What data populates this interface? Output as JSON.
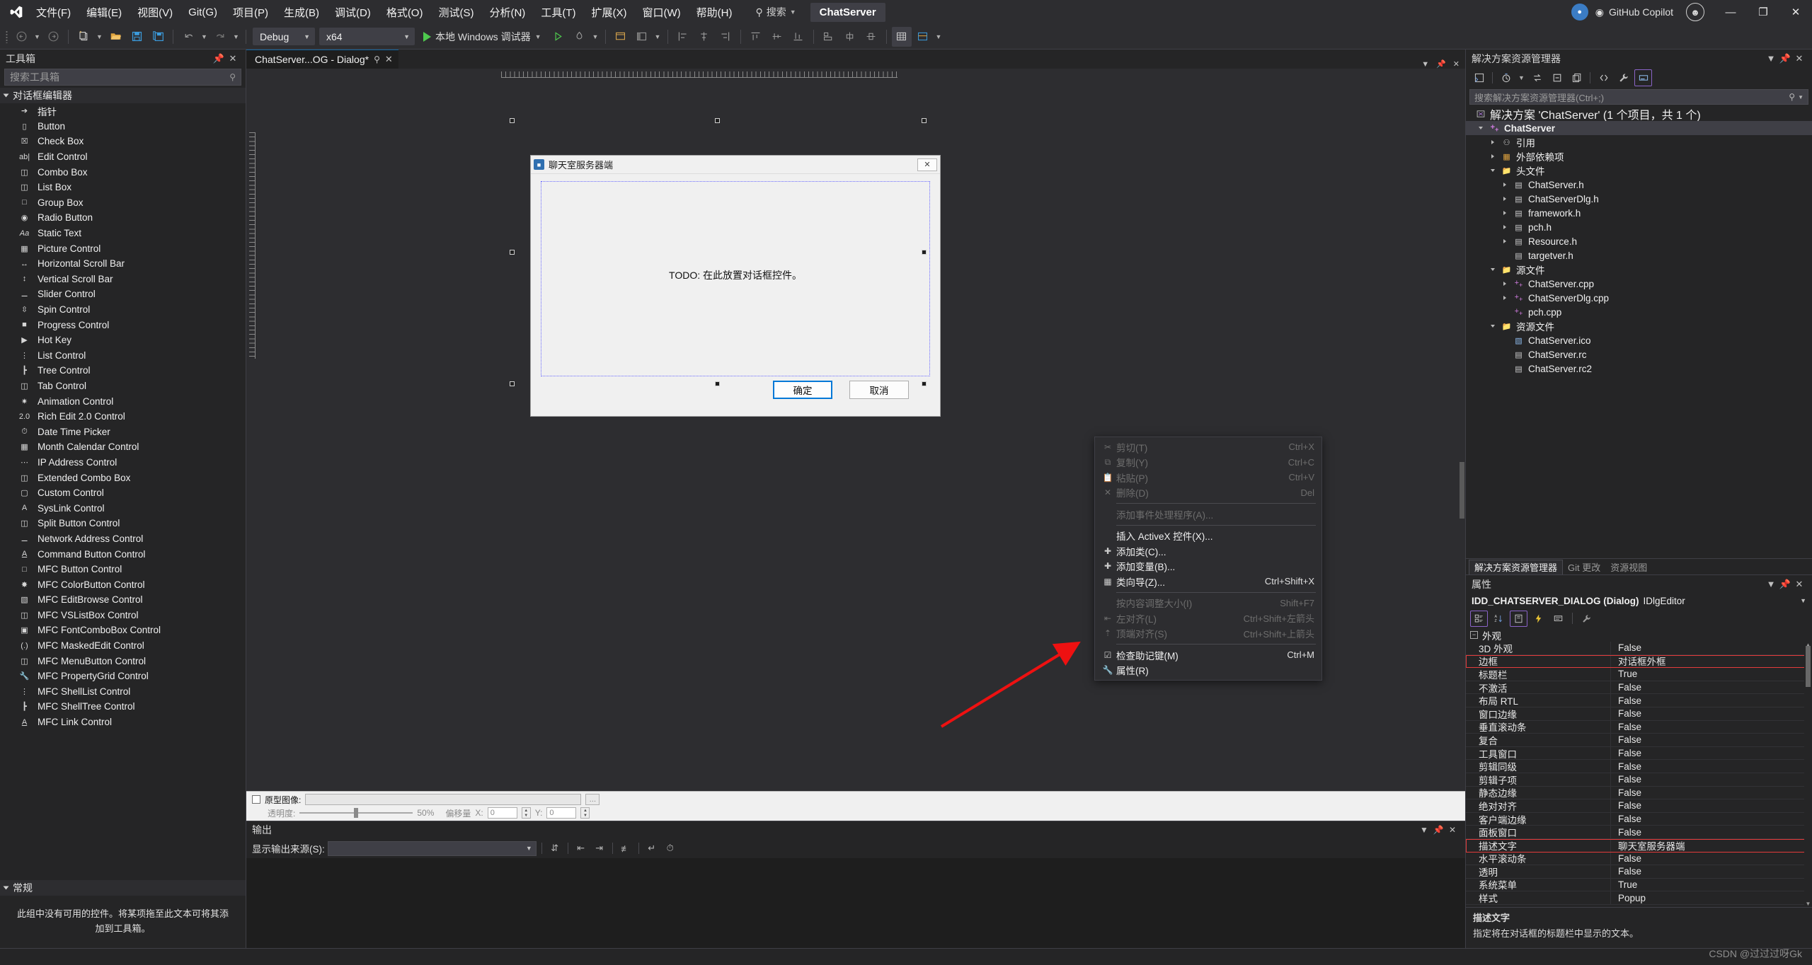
{
  "menubar": {
    "logo_icon": "visual-studio-logo",
    "items": [
      "文件(F)",
      "编辑(E)",
      "视图(V)",
      "Git(G)",
      "项目(P)",
      "生成(B)",
      "调试(D)",
      "格式(O)",
      "测试(S)",
      "分析(N)",
      "工具(T)",
      "扩展(X)",
      "窗口(W)",
      "帮助(H)"
    ],
    "search_label": "搜索",
    "project_chip": "ChatServer",
    "copilot_label": "GitHub Copilot",
    "minimize": "—",
    "maximize": "❐",
    "close": "✕"
  },
  "toolbar": {
    "back_icon": "arrow-back-icon",
    "forward_icon": "arrow-forward-icon",
    "new_project_icon": "new-project-icon",
    "open_icon": "open-folder-icon",
    "save_icon": "save-icon",
    "save_all_icon": "save-all-icon",
    "undo_icon": "undo-icon",
    "redo_icon": "redo-icon",
    "config": "Debug",
    "platform": "x64",
    "run_label": "本地 Windows 调试器",
    "hot_reload_icon": "hot-reload-icon"
  },
  "toolbox": {
    "title": "工具箱",
    "search_placeholder": "搜索工具箱",
    "group1": "对话框编辑器",
    "items": [
      {
        "label": "指针",
        "icon": "pointer-icon"
      },
      {
        "label": "Button",
        "icon": "button-icon"
      },
      {
        "label": "Check Box",
        "icon": "checkbox-icon"
      },
      {
        "label": "Edit Control",
        "icon": "edit-control-icon"
      },
      {
        "label": "Combo Box",
        "icon": "combobox-icon"
      },
      {
        "label": "List Box",
        "icon": "listbox-icon"
      },
      {
        "label": "Group Box",
        "icon": "groupbox-icon"
      },
      {
        "label": "Radio Button",
        "icon": "radio-icon"
      },
      {
        "label": "Static Text",
        "icon": "static-text-icon"
      },
      {
        "label": "Picture Control",
        "icon": "picture-icon"
      },
      {
        "label": "Horizontal Scroll Bar",
        "icon": "hscroll-icon"
      },
      {
        "label": "Vertical Scroll Bar",
        "icon": "vscroll-icon"
      },
      {
        "label": "Slider Control",
        "icon": "slider-icon"
      },
      {
        "label": "Spin Control",
        "icon": "spin-icon"
      },
      {
        "label": "Progress Control",
        "icon": "progress-icon"
      },
      {
        "label": "Hot Key",
        "icon": "hotkey-icon"
      },
      {
        "label": "List Control",
        "icon": "list-control-icon"
      },
      {
        "label": "Tree Control",
        "icon": "tree-control-icon"
      },
      {
        "label": "Tab Control",
        "icon": "tab-control-icon"
      },
      {
        "label": "Animation Control",
        "icon": "animation-icon"
      },
      {
        "label": "Rich Edit 2.0 Control",
        "icon": "richedit-icon"
      },
      {
        "label": "Date Time Picker",
        "icon": "datetime-icon"
      },
      {
        "label": "Month Calendar Control",
        "icon": "calendar-icon"
      },
      {
        "label": "IP Address Control",
        "icon": "ip-address-icon"
      },
      {
        "label": "Extended Combo Box",
        "icon": "ext-combo-icon"
      },
      {
        "label": "Custom Control",
        "icon": "custom-control-icon"
      },
      {
        "label": "SysLink Control",
        "icon": "syslink-icon"
      },
      {
        "label": "Split Button Control",
        "icon": "split-button-icon"
      },
      {
        "label": "Network Address Control",
        "icon": "network-address-icon"
      },
      {
        "label": "Command Button Control",
        "icon": "command-button-icon"
      },
      {
        "label": "MFC Button Control",
        "icon": "mfc-button-icon"
      },
      {
        "label": "MFC ColorButton Control",
        "icon": "mfc-colorbutton-icon"
      },
      {
        "label": "MFC EditBrowse Control",
        "icon": "mfc-editbrowse-icon"
      },
      {
        "label": "MFC VSListBox Control",
        "icon": "mfc-vslistbox-icon"
      },
      {
        "label": "MFC FontComboBox Control",
        "icon": "mfc-fontcombo-icon"
      },
      {
        "label": "MFC MaskedEdit Control",
        "icon": "mfc-maskededit-icon"
      },
      {
        "label": "MFC MenuButton Control",
        "icon": "mfc-menubutton-icon"
      },
      {
        "label": "MFC PropertyGrid Control",
        "icon": "mfc-propertygrid-icon"
      },
      {
        "label": "MFC ShellList Control",
        "icon": "mfc-shelllist-icon"
      },
      {
        "label": "MFC ShellTree Control",
        "icon": "mfc-shelltree-icon"
      },
      {
        "label": "MFC Link Control",
        "icon": "mfc-link-icon"
      }
    ],
    "group2": "常规",
    "empty_note": "此组中没有可用的控件。将某项拖至此文本可将其添加到工具箱。"
  },
  "document_tab": {
    "title": "ChatServer...OG - Dialog*",
    "pin_icon": "pin-icon",
    "close_icon": "close-icon"
  },
  "dialog_designer": {
    "dialog_title": "聊天室服务器端",
    "title_icon": "app-icon",
    "close_button": "✕",
    "todo_text": "TODO: 在此放置对话框控件。",
    "ok_button": "确定",
    "cancel_button": "取消"
  },
  "context_menu": {
    "items": [
      {
        "label": "剪切(T)",
        "shortcut": "Ctrl+X",
        "icon": "cut-icon",
        "disabled": true
      },
      {
        "label": "复制(Y)",
        "shortcut": "Ctrl+C",
        "icon": "copy-icon",
        "disabled": true
      },
      {
        "label": "粘贴(P)",
        "shortcut": "Ctrl+V",
        "icon": "paste-icon",
        "disabled": true
      },
      {
        "label": "删除(D)",
        "shortcut": "Del",
        "icon": "delete-icon",
        "disabled": true
      },
      {
        "sep": true
      },
      {
        "label": "添加事件处理程序(A)...",
        "shortcut": "",
        "icon": "",
        "disabled": true
      },
      {
        "sep": true
      },
      {
        "label": "插入 ActiveX 控件(X)...",
        "shortcut": "",
        "icon": "",
        "disabled": false
      },
      {
        "label": "添加类(C)...",
        "shortcut": "",
        "icon": "add-class-icon",
        "disabled": false
      },
      {
        "label": "添加变量(B)...",
        "shortcut": "",
        "icon": "add-variable-icon",
        "disabled": false
      },
      {
        "label": "类向导(Z)...",
        "shortcut": "Ctrl+Shift+X",
        "icon": "class-wizard-icon",
        "disabled": false
      },
      {
        "sep": true
      },
      {
        "label": "按内容调整大小(I)",
        "shortcut": "Shift+F7",
        "icon": "",
        "disabled": true
      },
      {
        "label": "左对齐(L)",
        "shortcut": "Ctrl+Shift+左箭头",
        "icon": "align-left-icon",
        "disabled": true
      },
      {
        "label": "顶端对齐(S)",
        "shortcut": "Ctrl+Shift+上箭头",
        "icon": "align-top-icon",
        "disabled": true
      },
      {
        "sep": true
      },
      {
        "label": "检查助记键(M)",
        "shortcut": "Ctrl+M",
        "icon": "check-mnemonic-icon",
        "disabled": false
      },
      {
        "label": "属性(R)",
        "shortcut": "",
        "icon": "properties-wrench-icon",
        "disabled": false
      }
    ]
  },
  "prototype_bar": {
    "checkbox_label": "原型图像:",
    "image_path": "",
    "browse": "…",
    "opacity_label": "透明度:",
    "opacity_value": "50%",
    "offset_label": "偏移量",
    "offset_x_label": "X:",
    "offset_x": "0",
    "offset_y_label": "Y:",
    "offset_y": "0"
  },
  "output_panel": {
    "title": "输出",
    "source_label": "显示输出来源(S):",
    "source_value": "",
    "icons": [
      "jump-to-icon",
      "outdent-icon",
      "indent-icon",
      "clear-all-icon",
      "word-wrap-icon",
      "history-icon"
    ],
    "dropdown_icon": "chevron-down-icon",
    "pin_icon": "pin-icon",
    "close_icon": "close-icon"
  },
  "solution_explorer": {
    "title": "解决方案资源管理器",
    "toolbar_icons": [
      "code-view-icon",
      "pending-changes-icon",
      "sync-icon",
      "collapse-all-icon",
      "copy-icon",
      "show-all-files-icon",
      "properties-wrench-icon",
      "home-icon"
    ],
    "search_placeholder": "搜索解决方案资源管理器(Ctrl+;)",
    "solution_line": "解决方案 'ChatServer' (1 个项目，共 1 个)",
    "tree": [
      {
        "label": "ChatServer",
        "indent": 0,
        "expand": "open",
        "icon": "cpp-project-icon",
        "bold": true,
        "selected": true
      },
      {
        "label": "引用",
        "indent": 1,
        "expand": "closed",
        "icon": "references-icon",
        "bold": false
      },
      {
        "label": "外部依赖项",
        "indent": 1,
        "expand": "closed",
        "icon": "external-deps-icon",
        "bold": false
      },
      {
        "label": "头文件",
        "indent": 1,
        "expand": "open",
        "icon": "filter-folder-icon",
        "bold": false
      },
      {
        "label": "ChatServer.h",
        "indent": 2,
        "expand": "closed",
        "icon": "header-file-icon",
        "bold": false
      },
      {
        "label": "ChatServerDlg.h",
        "indent": 2,
        "expand": "closed",
        "icon": "header-file-icon",
        "bold": false
      },
      {
        "label": "framework.h",
        "indent": 2,
        "expand": "closed",
        "icon": "header-file-icon",
        "bold": false
      },
      {
        "label": "pch.h",
        "indent": 2,
        "expand": "closed",
        "icon": "header-file-icon",
        "bold": false
      },
      {
        "label": "Resource.h",
        "indent": 2,
        "expand": "closed",
        "icon": "header-file-icon",
        "bold": false
      },
      {
        "label": "targetver.h",
        "indent": 2,
        "expand": "none",
        "icon": "header-file-icon",
        "bold": false
      },
      {
        "label": "源文件",
        "indent": 1,
        "expand": "open",
        "icon": "filter-folder-icon",
        "bold": false
      },
      {
        "label": "ChatServer.cpp",
        "indent": 2,
        "expand": "closed",
        "icon": "cpp-file-icon",
        "bold": false
      },
      {
        "label": "ChatServerDlg.cpp",
        "indent": 2,
        "expand": "closed",
        "icon": "cpp-file-icon",
        "bold": false
      },
      {
        "label": "pch.cpp",
        "indent": 2,
        "expand": "none",
        "icon": "cpp-file-icon",
        "bold": false
      },
      {
        "label": "资源文件",
        "indent": 1,
        "expand": "open",
        "icon": "filter-folder-icon",
        "bold": false
      },
      {
        "label": "ChatServer.ico",
        "indent": 2,
        "expand": "none",
        "icon": "image-file-icon",
        "bold": false
      },
      {
        "label": "ChatServer.rc",
        "indent": 2,
        "expand": "none",
        "icon": "resource-file-icon",
        "bold": false
      },
      {
        "label": "ChatServer.rc2",
        "indent": 2,
        "expand": "none",
        "icon": "resource-file-icon",
        "bold": false
      }
    ],
    "bottom_tabs": [
      {
        "label": "解决方案资源管理器",
        "active": true
      },
      {
        "label": "Git 更改",
        "active": false
      },
      {
        "label": "资源视图",
        "active": false
      }
    ]
  },
  "properties": {
    "title": "属性",
    "object_name": "IDD_CHATSERVER_DIALOG (Dialog)",
    "object_type": "IDlgEditor",
    "toolbar_icons": [
      "categorized-icon",
      "alphabetical-icon",
      "properties-page-icon",
      "events-icon",
      "messages-icon",
      "property-pages-key-icon"
    ],
    "category": "外观",
    "rows": [
      {
        "key": "3D 外观",
        "value": "False",
        "highlight": false
      },
      {
        "key": "边框",
        "value": "对话框外框",
        "highlight": true
      },
      {
        "key": "标题栏",
        "value": "True",
        "highlight": false
      },
      {
        "key": "不激活",
        "value": "False",
        "highlight": false
      },
      {
        "key": "布局 RTL",
        "value": "False",
        "highlight": false
      },
      {
        "key": "窗口边缘",
        "value": "False",
        "highlight": false
      },
      {
        "key": "垂直滚动条",
        "value": "False",
        "highlight": false
      },
      {
        "key": "复合",
        "value": "False",
        "highlight": false
      },
      {
        "key": "工具窗口",
        "value": "False",
        "highlight": false
      },
      {
        "key": "剪辑同级",
        "value": "False",
        "highlight": false
      },
      {
        "key": "剪辑子项",
        "value": "False",
        "highlight": false
      },
      {
        "key": "静态边缘",
        "value": "False",
        "highlight": false
      },
      {
        "key": "绝对对齐",
        "value": "False",
        "highlight": false
      },
      {
        "key": "客户端边缘",
        "value": "False",
        "highlight": false
      },
      {
        "key": "面板窗口",
        "value": "False",
        "highlight": false
      },
      {
        "key": "描述文字",
        "value": "聊天室服务器端",
        "highlight": true
      },
      {
        "key": "水平滚动条",
        "value": "False",
        "highlight": false
      },
      {
        "key": "透明",
        "value": "False",
        "highlight": false
      },
      {
        "key": "系统菜单",
        "value": "True",
        "highlight": false
      },
      {
        "key": "样式",
        "value": "Popup",
        "highlight": false
      }
    ],
    "desc_title": "描述文字",
    "desc_body": "指定将在对话框的标题栏中显示的文本。"
  },
  "watermark": "CSDN @过过过呀Gk",
  "colors": {
    "accent": "#0e639c",
    "highlight_red": "#e33b3b",
    "purple_border": "#8a64c8",
    "green_play": "#4ec94e",
    "arrow_red": "#ee1111"
  }
}
